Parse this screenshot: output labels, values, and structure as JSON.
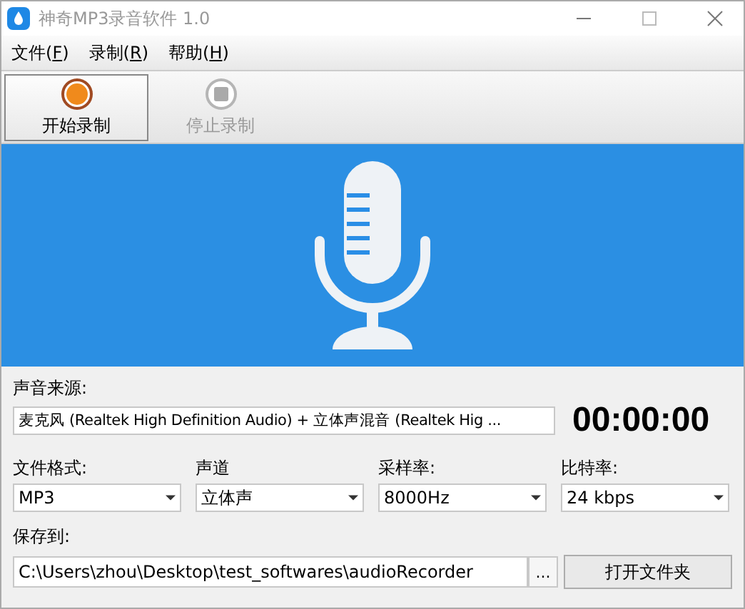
{
  "window": {
    "title": "神奇MP3录音软件 1.0"
  },
  "menu": [
    {
      "prefix": "文件(",
      "key": "F",
      "suffix": ")"
    },
    {
      "prefix": "录制(",
      "key": "R",
      "suffix": ")"
    },
    {
      "prefix": "帮助(",
      "key": "H",
      "suffix": ")"
    }
  ],
  "toolbar": [
    {
      "label": "开始录制",
      "kind": "record",
      "disabled": false
    },
    {
      "label": "停止录制",
      "kind": "stop",
      "disabled": true
    }
  ],
  "source": {
    "label": "声音来源:",
    "value": "麦克风 (Realtek High Definition Audio) + 立体声混音 (Realtek Hig ..."
  },
  "timer": "00:00:00",
  "settings": [
    {
      "label": "文件格式:",
      "value": "MP3"
    },
    {
      "label": "声道",
      "value": "立体声"
    },
    {
      "label": "采样率:",
      "value": "8000Hz"
    },
    {
      "label": "比特率:",
      "value": "24 kbps"
    }
  ],
  "save": {
    "label": "保存到:",
    "path": "C:\\Users\\zhou\\Desktop\\test_softwares\\audioRecorder",
    "browse": "...",
    "open_folder": "打开文件夹"
  }
}
